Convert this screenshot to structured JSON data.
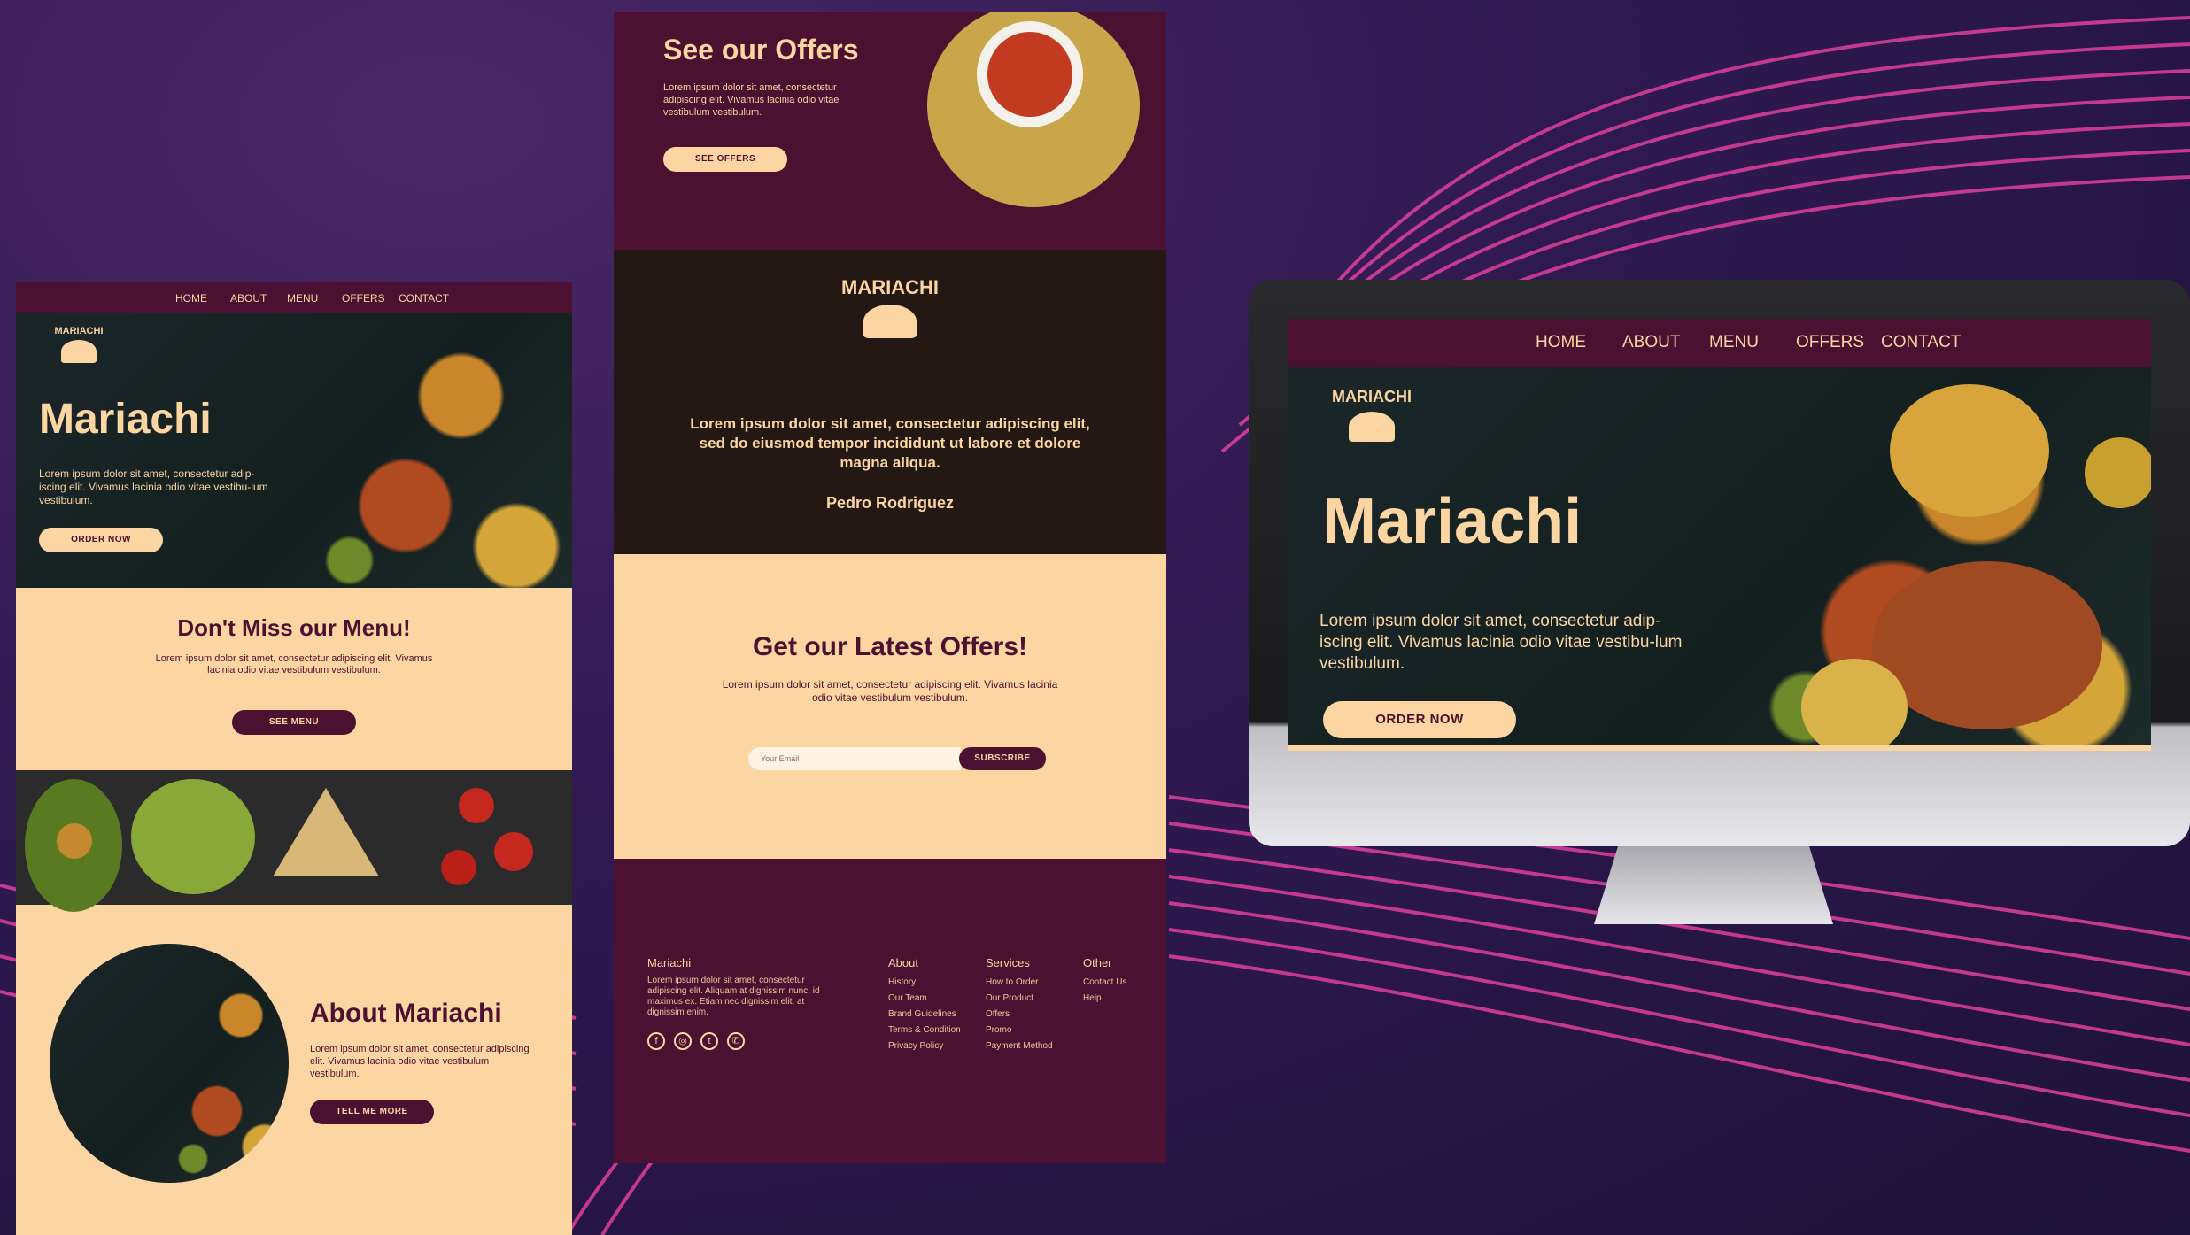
{
  "brand": {
    "name": "Mariachi",
    "logo_text": "MARIACHI"
  },
  "nav": {
    "items": [
      "HOME",
      "ABOUT",
      "MENU",
      "OFFERS",
      "CONTACT"
    ]
  },
  "hero": {
    "title": "Mariachi",
    "body": "Lorem ipsum dolor sit amet, consectetur adip-iscing elit. Vivamus lacinia odio vitae vestibu-lum vestibulum.",
    "cta": "ORDER NOW"
  },
  "menu_section": {
    "title": "Don't Miss our Menu!",
    "body": "Lorem ipsum dolor sit amet, consectetur adipiscing elit. Vivamus lacinia odio vitae vestibulum vestibulum.",
    "cta": "SEE MENU"
  },
  "about_section": {
    "title": "About Mariachi",
    "body": "Lorem ipsum dolor sit amet, consectetur adipiscing elit. Vivamus lacinia odio vitae vestibulum vestibulum.",
    "cta": "TELL ME MORE"
  },
  "offers_section": {
    "title": "See our Offers",
    "body": "Lorem ipsum dolor sit amet, consectetur adipiscing elit. Vivamus lacinia odio vitae vestibulum vestibulum.",
    "cta": "SEE OFFERS"
  },
  "testimonial": {
    "quote": "Lorem ipsum dolor sit amet, consectetur adipiscing elit, sed do eiusmod tempor incididunt ut labore et dolore magna aliqua.",
    "author": "Pedro Rodriguez"
  },
  "newsletter": {
    "title": "Get our Latest Offers!",
    "body": "Lorem ipsum dolor sit amet, consectetur adipiscing elit. Vivamus lacinia odio vitae vestibulum vestibulum.",
    "placeholder": "Your Email",
    "cta": "SUBSCRIBE"
  },
  "footer": {
    "brand": "Mariachi",
    "brand_text": "Lorem ipsum dolor sit amet, consectetur adipiscing elit. Aliquam at dignissim nunc, id maximus ex. Etiam nec dignissim elit, at dignissim enim.",
    "columns": [
      {
        "title": "About",
        "links": [
          "History",
          "Our Team",
          "Brand Guidelines",
          "Terms & Condition",
          "Privacy Policy"
        ]
      },
      {
        "title": "Services",
        "links": [
          "How to Order",
          "Our Product",
          "Offers",
          "Promo",
          "Payment Method"
        ]
      },
      {
        "title": "Other",
        "links": [
          "Contact Us",
          "Help"
        ]
      }
    ],
    "social_icons": [
      "facebook-icon",
      "instagram-icon",
      "twitter-icon",
      "whatsapp-icon"
    ]
  },
  "colors": {
    "maroon": "#4c1030",
    "cream": "#fbd5a2",
    "background": "#2a1646",
    "accent_pink": "#e040a0"
  }
}
